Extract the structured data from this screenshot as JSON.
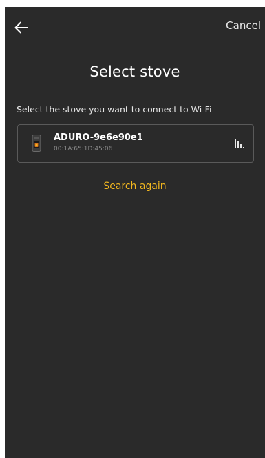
{
  "header": {
    "back_icon": "arrow-left-icon",
    "cancel_label": "Cancel"
  },
  "page": {
    "title": "Select stove",
    "instructions": "Select the stove you want to connect to Wi-Fi"
  },
  "devices": [
    {
      "name": "ADURO-9e6e90e1",
      "mac": "00:1A:65:1D:45:06",
      "icon": "stove-icon",
      "signal_icon": "signal-strength-icon"
    }
  ],
  "actions": {
    "search_again_label": "Search again"
  },
  "colors": {
    "background": "#2a2a2a",
    "accent": "#f2b71f",
    "card_border": "#5a5a5a"
  }
}
